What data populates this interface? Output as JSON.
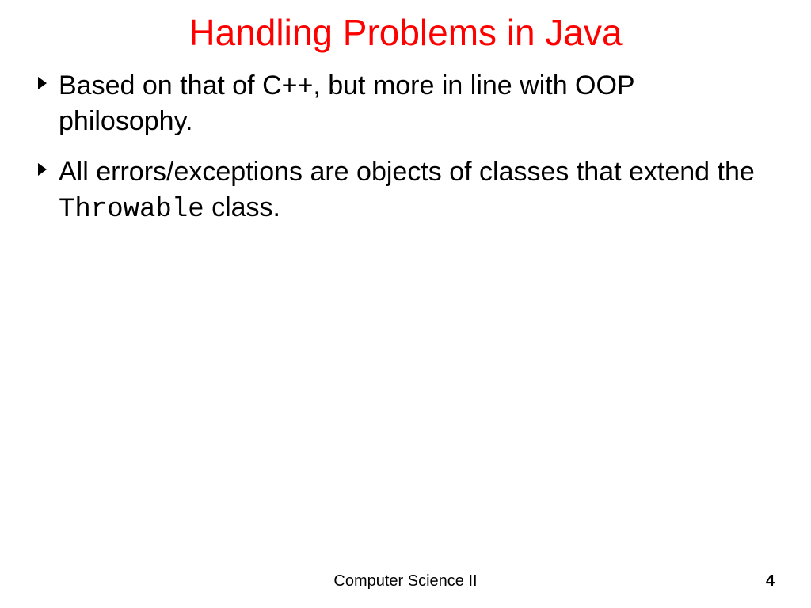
{
  "title": "Handling Problems in Java",
  "bullets": [
    {
      "pre": "Based on that of C++, but more in line with OOP philosophy.",
      "mono": "",
      "post": ""
    },
    {
      "pre": "All errors/exceptions are objects of classes that extend the ",
      "mono": "Throwable",
      "post": " class."
    }
  ],
  "footer": "Computer Science II",
  "page_number": "4"
}
